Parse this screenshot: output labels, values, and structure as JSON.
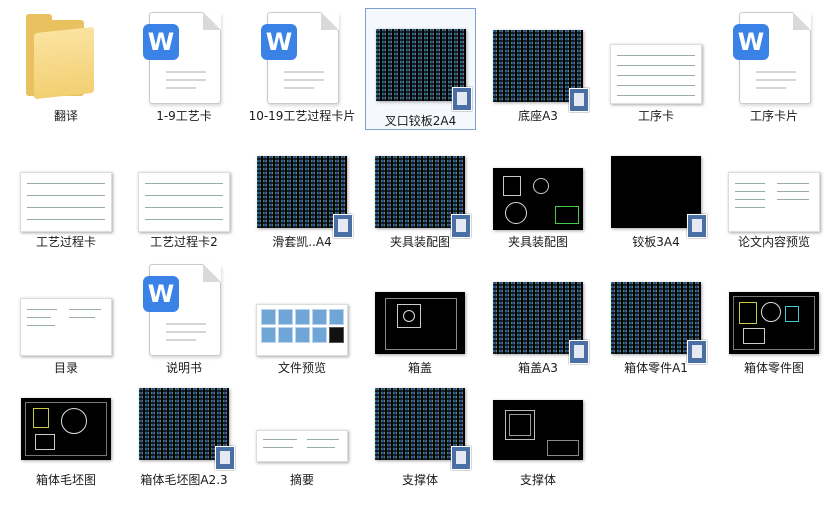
{
  "files": [
    {
      "name": "翻译",
      "kind": "folder"
    },
    {
      "name": "1-9工艺卡",
      "kind": "word"
    },
    {
      "name": "10-19工艺过程卡片",
      "kind": "word"
    },
    {
      "name": "叉口铰板2A4",
      "kind": "cad-noise",
      "selected": true
    },
    {
      "name": "底座A3",
      "kind": "cad-noise"
    },
    {
      "name": "工序卡",
      "kind": "table-white"
    },
    {
      "name": "工序卡片",
      "kind": "word"
    },
    {
      "name": "工艺过程卡",
      "kind": "table-white"
    },
    {
      "name": "工艺过程卡2",
      "kind": "table-white"
    },
    {
      "name": "滑套凯..A4",
      "kind": "cad-noise"
    },
    {
      "name": "夹具装配图",
      "kind": "cad-noise"
    },
    {
      "name": "夹具装配图",
      "kind": "cad-dark"
    },
    {
      "name": "铰板3A4",
      "kind": "cad-black"
    },
    {
      "name": "论文内容预览",
      "kind": "doc-white"
    },
    {
      "name": "目录",
      "kind": "doc-white"
    },
    {
      "name": "说明书",
      "kind": "word"
    },
    {
      "name": "文件预览",
      "kind": "preview-blue"
    },
    {
      "name": "箱盖",
      "kind": "cad-dark"
    },
    {
      "name": "箱盖A3",
      "kind": "cad-noise"
    },
    {
      "name": "箱体零件A1",
      "kind": "cad-noise"
    },
    {
      "name": "箱体零件图",
      "kind": "cad-dark"
    },
    {
      "name": "箱体毛坯图",
      "kind": "cad-dark"
    },
    {
      "name": "箱体毛坯图A2.3",
      "kind": "cad-noise"
    },
    {
      "name": "摘要",
      "kind": "doc-white"
    },
    {
      "name": "支撑体",
      "kind": "cad-noise"
    },
    {
      "name": "支撑体",
      "kind": "cad-dark"
    }
  ],
  "colors": {
    "selection_border": "#7da2ce",
    "word_blue": "#3b82e6",
    "folder": "#e9c15f"
  }
}
